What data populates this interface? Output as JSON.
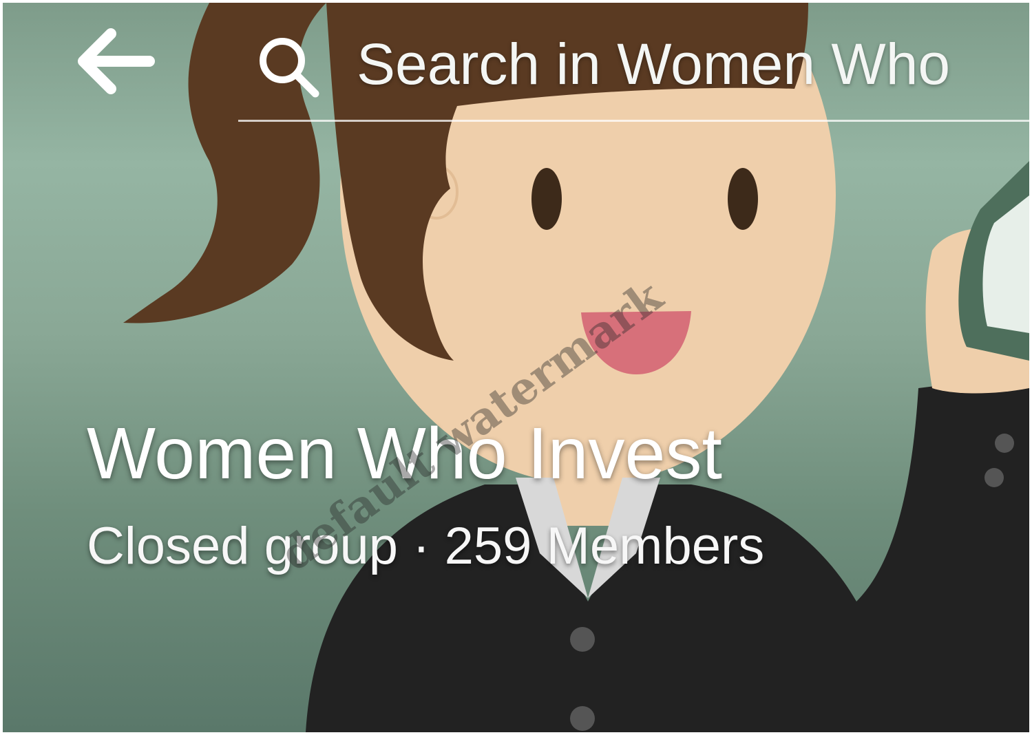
{
  "header": {
    "back_icon": "arrow-left-icon",
    "search_icon": "search-icon",
    "search_placeholder": "Search in Women Who"
  },
  "group": {
    "name": "Women Who Invest",
    "privacy": "Closed group",
    "separator": "·",
    "member_count": "259",
    "members_label": "Members"
  },
  "cover": {
    "description_icon": "cover-photo-woman-holding-money",
    "colors": {
      "background": "#8aa896",
      "hair": "#5a3a22",
      "skin": "#efcfab",
      "jacket": "#222222",
      "mouth": "#d7707a",
      "money": "#4e6f5c"
    }
  },
  "watermark": {
    "text": "default watermark"
  }
}
